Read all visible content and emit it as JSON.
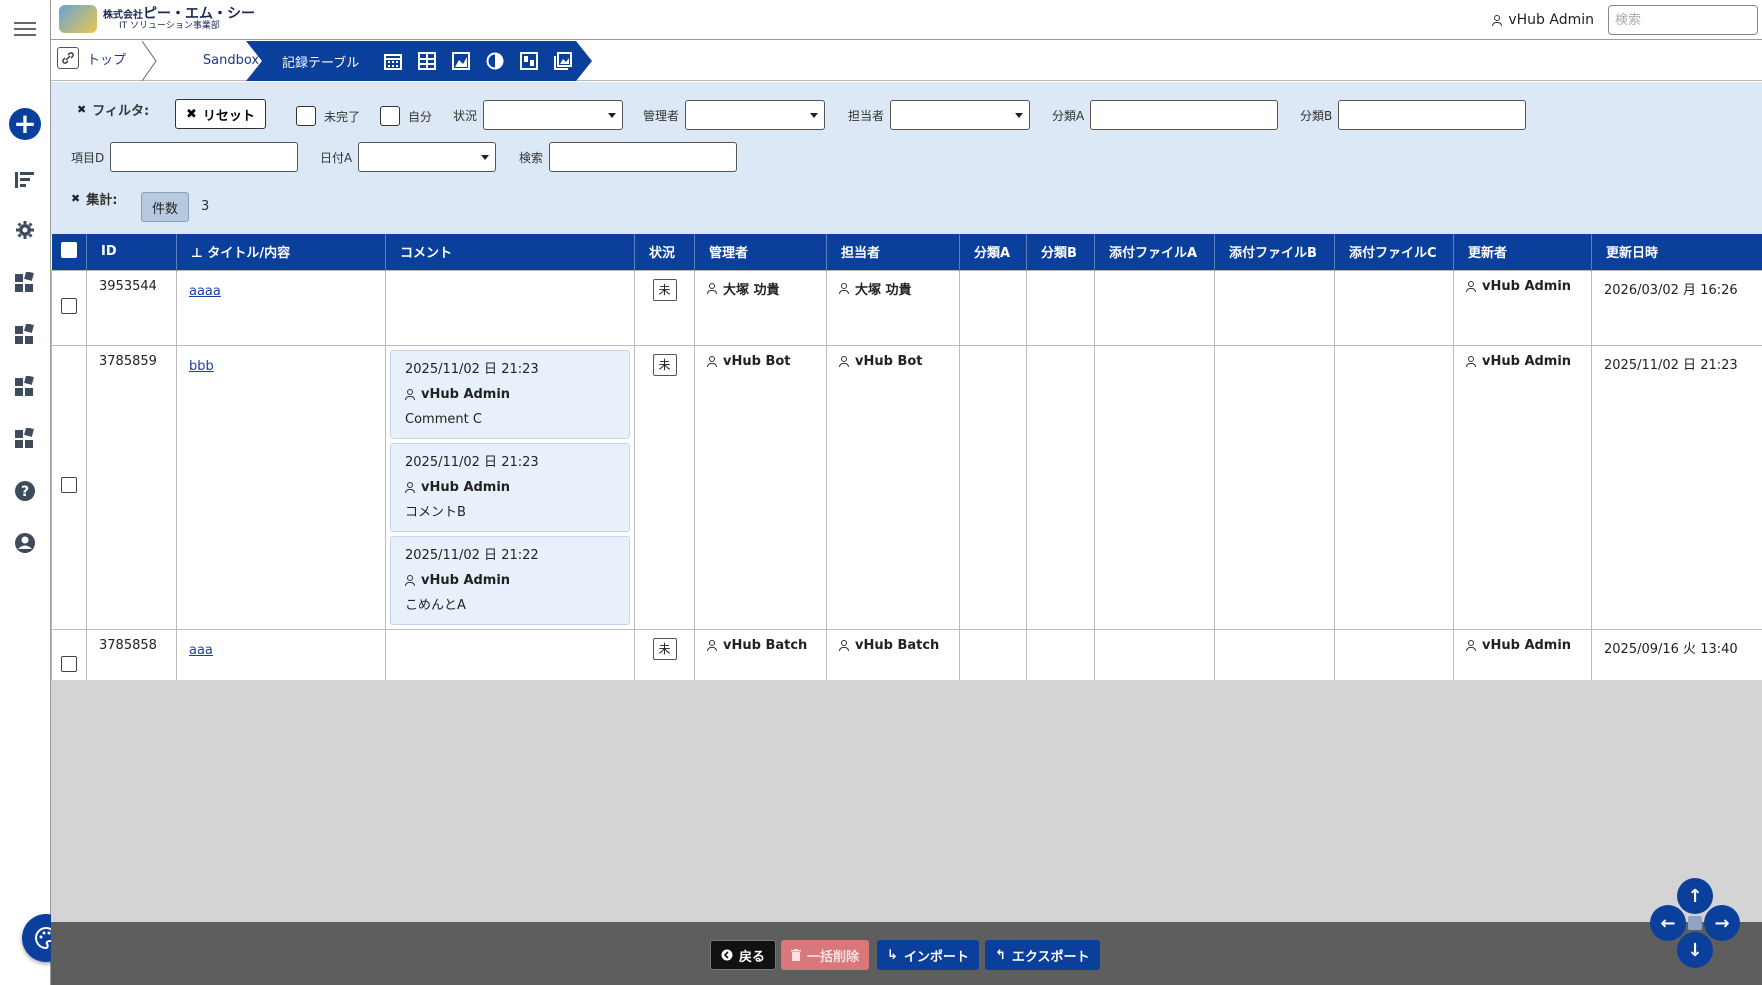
{
  "header": {
    "company": "株式会社",
    "company_brand": "ピー・エム・シー",
    "division": "IT ソリューション事業部",
    "user": "vHub Admin",
    "search_placeholder": "検索"
  },
  "breadcrumb": {
    "home_icon": "link-icon",
    "items": [
      "トップ",
      "Sandbox",
      "記録テーブル"
    ],
    "view_icons": [
      "calendar-icon",
      "table-icon",
      "chart-area-icon",
      "pie-icon",
      "kanban-icon",
      "gallery-icon"
    ]
  },
  "filters": {
    "title": "フィルタ:",
    "reset": "リセット",
    "checkbox_incomplete": "未完了",
    "checkbox_self": "自分",
    "status_label": "状況",
    "manager_label": "管理者",
    "assignee_label": "担当者",
    "class_a_label": "分類A",
    "class_b_label": "分類B",
    "item_d_label": "項目D",
    "date_a_label": "日付A",
    "search_label": "検索",
    "aggregate_title": "集計:",
    "aggregate_type": "件数",
    "aggregate_value": "3"
  },
  "table": {
    "columns": [
      "ID",
      "タイトル/内容",
      "コメント",
      "状況",
      "管理者",
      "担当者",
      "分類A",
      "分類B",
      "添付ファイルA",
      "添付ファイルB",
      "添付ファイルC",
      "更新者",
      "更新日時"
    ],
    "rows": [
      {
        "id": "3953544",
        "title": "aaaa",
        "status": "未",
        "manager": "大塚 功貴",
        "assignee": "大塚 功貴",
        "updater": "vHub Admin",
        "updated": "2026/03/02 月 16:26",
        "comments": []
      },
      {
        "id": "3785859",
        "title": "bbb",
        "status": "未",
        "manager": "vHub Bot",
        "assignee": "vHub Bot",
        "updater": "vHub Admin",
        "updated": "2025/11/02 日 21:23",
        "comments": [
          {
            "date": "2025/11/02 日 21:23",
            "user": "vHub Admin",
            "body": "Comment C"
          },
          {
            "date": "2025/11/02 日 21:23",
            "user": "vHub Admin",
            "body": "コメントB"
          },
          {
            "date": "2025/11/02 日 21:22",
            "user": "vHub Admin",
            "body": "こめんとA"
          }
        ]
      },
      {
        "id": "3785858",
        "title": "aaa",
        "status": "未",
        "manager": "vHub Batch",
        "assignee": "vHub Batch",
        "updater": "vHub Admin",
        "updated": "2025/09/16 火 13:40",
        "comments": []
      }
    ]
  },
  "footer": {
    "back": "戻る",
    "bulk_delete": "一括削除",
    "import": "インポート",
    "export": "エクスポート"
  },
  "colors": {
    "accent": "#0a3f9c",
    "filter_bg": "#dce8f5",
    "footer_bg": "#5e5e5e",
    "delete_btn": "#d9787a"
  }
}
